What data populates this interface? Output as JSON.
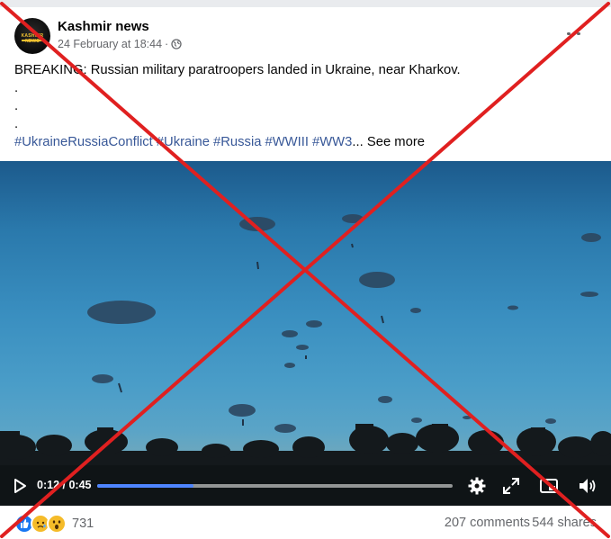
{
  "post": {
    "page_name": "Kashmir news",
    "timestamp": "24 February at 18:44",
    "separator": "·",
    "privacy_icon": "globe-icon",
    "avatar_text": "KASHMIR NEWS",
    "text_main": "BREAKING: Russian military paratroopers landed in Ukraine, near Kharkov.",
    "dot_lines": [
      ".",
      ".",
      "."
    ],
    "hashtags": [
      "#UkraineRussiaConflict",
      "#Ukraine",
      "#Russia",
      "#WWIII",
      "#WW3"
    ],
    "ellipsis": "...",
    "see_more": "See more"
  },
  "video": {
    "current_time": "0:12",
    "time_separator": "/",
    "duration": "0:45",
    "progress_fraction": 0.27,
    "controls": [
      "play-icon",
      "settings-icon",
      "fullscreen-icon",
      "picture-in-picture-icon",
      "volume-icon"
    ]
  },
  "engagement": {
    "reaction_icons": [
      "like-icon",
      "sad-icon",
      "wow-icon"
    ],
    "reaction_count": "731",
    "comments": "207 comments",
    "shares": "544 shares"
  },
  "overlay": {
    "mark": "red-x-mark",
    "color": "#e02020"
  },
  "colors": {
    "hashtag": "#385898",
    "secondary_text": "#65676b",
    "progress": "#4e85ff"
  }
}
